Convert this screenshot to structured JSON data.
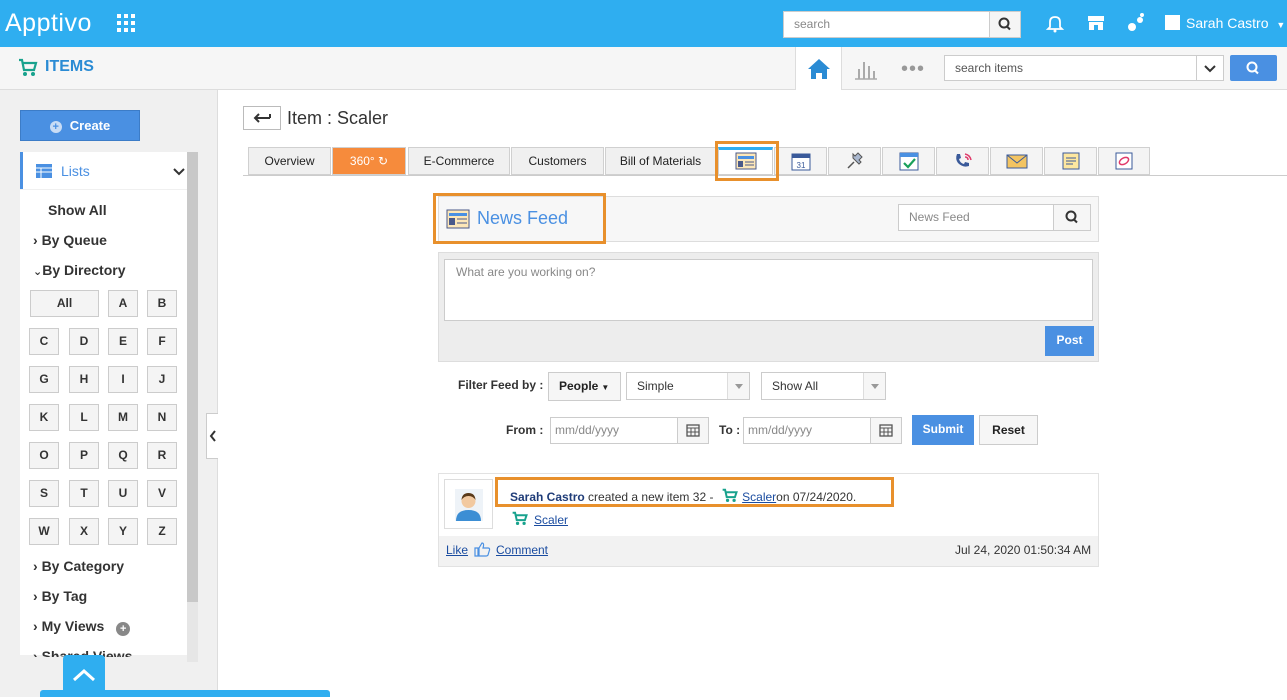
{
  "header": {
    "logo": "Apptivo",
    "search_placeholder": "search",
    "user_name": "Sarah Castro"
  },
  "subheader": {
    "app_title": "ITEMS",
    "search_items_placeholder": "search items"
  },
  "sidebar": {
    "create_label": "Create",
    "lists_label": "Lists",
    "show_all": "Show All",
    "by_queue": "By Queue",
    "by_directory": "By Directory",
    "letters": [
      "All",
      "A",
      "B",
      "C",
      "D",
      "E",
      "F",
      "G",
      "H",
      "I",
      "J",
      "K",
      "L",
      "M",
      "N",
      "O",
      "P",
      "Q",
      "R",
      "S",
      "T",
      "U",
      "V",
      "W",
      "X",
      "Y",
      "Z"
    ],
    "by_category": "By Category",
    "by_tag": "By Tag",
    "my_views": "My Views",
    "shared_views": "Shared Views"
  },
  "main": {
    "title": "Item : Scaler",
    "tabs": [
      "Overview",
      "360°",
      "E-Commerce",
      "Customers",
      "Bill of Materials"
    ]
  },
  "news_feed": {
    "title": "News Feed",
    "search_placeholder": "News Feed",
    "post_placeholder": "What are you working on?",
    "post_button": "Post",
    "filter_label": "Filter Feed by :",
    "people": "People",
    "simple": "Simple",
    "show_all": "Show All",
    "from_label": "From :",
    "to_label": "To :",
    "date_placeholder": "mm/dd/yyyy",
    "submit": "Submit",
    "reset": "Reset"
  },
  "feed_item": {
    "author": "Sarah Castro",
    "action": "created a new item 32 -",
    "item_link": "Scaler",
    "date_text": "on 07/24/2020.",
    "sub_link": "Scaler",
    "like": "Like",
    "comment": "Comment",
    "timestamp": "Jul 24, 2020 01:50:34 AM"
  },
  "colors": {
    "brand": "#2faef0",
    "accent": "#4a90e2",
    "highlight": "#e8902c",
    "tab_360": "#f68b3c"
  }
}
